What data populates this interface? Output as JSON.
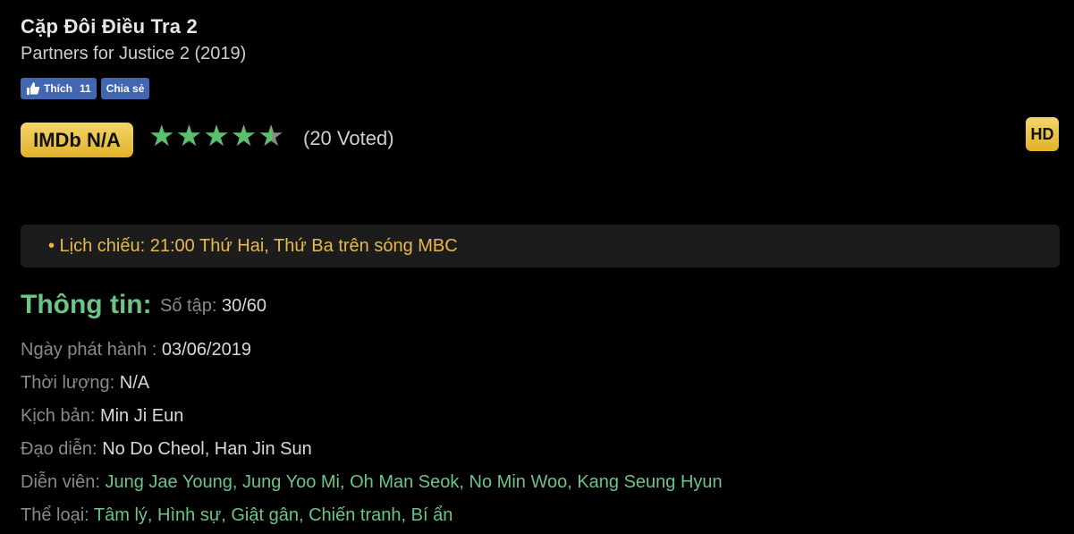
{
  "title": "Cặp Đôi Điều Tra 2",
  "subtitle": "Partners for Justice 2 (2019)",
  "social": {
    "like_label": "Thích",
    "like_count": "11",
    "share_label": "Chia sẻ"
  },
  "rating": {
    "imdb": "IMDb N/A",
    "stars": 4.5,
    "stars_max": 5,
    "voted": "(20 Voted)"
  },
  "quality_badge": "HD",
  "schedule": "• Lịch chiếu: 21:00 Thứ Hai, Thứ Ba trên sóng MBC",
  "info": {
    "heading": "Thông tin:",
    "episodes_label": "Số tập:",
    "episodes_value": "30/60",
    "release_label": "Ngày phát hành :",
    "release_value": "03/06/2019",
    "duration_label": "Thời lượng:",
    "duration_value": "N/A",
    "writer_label": "Kịch bản:",
    "writer_value": "Min Ji Eun",
    "director_label": "Đạo diễn:",
    "director_value": "No Do Cheol, Han Jin Sun",
    "cast_label": "Diễn viên:",
    "cast": [
      "Jung Jae Young",
      "Jung Yoo Mi",
      "Oh Man Seok",
      "No Min Woo",
      "Kang Seung Hyun"
    ],
    "genre_label": "Thể loại:",
    "genres": [
      "Tâm lý",
      "Hình sự",
      "Giật gân",
      "Chiến tranh",
      "Bí ẩn"
    ]
  },
  "colors": {
    "accent_green": "#6cc487",
    "gold": "#e0b22a",
    "facebook_blue": "#4267b2",
    "schedule_text": "#e8b84a"
  }
}
